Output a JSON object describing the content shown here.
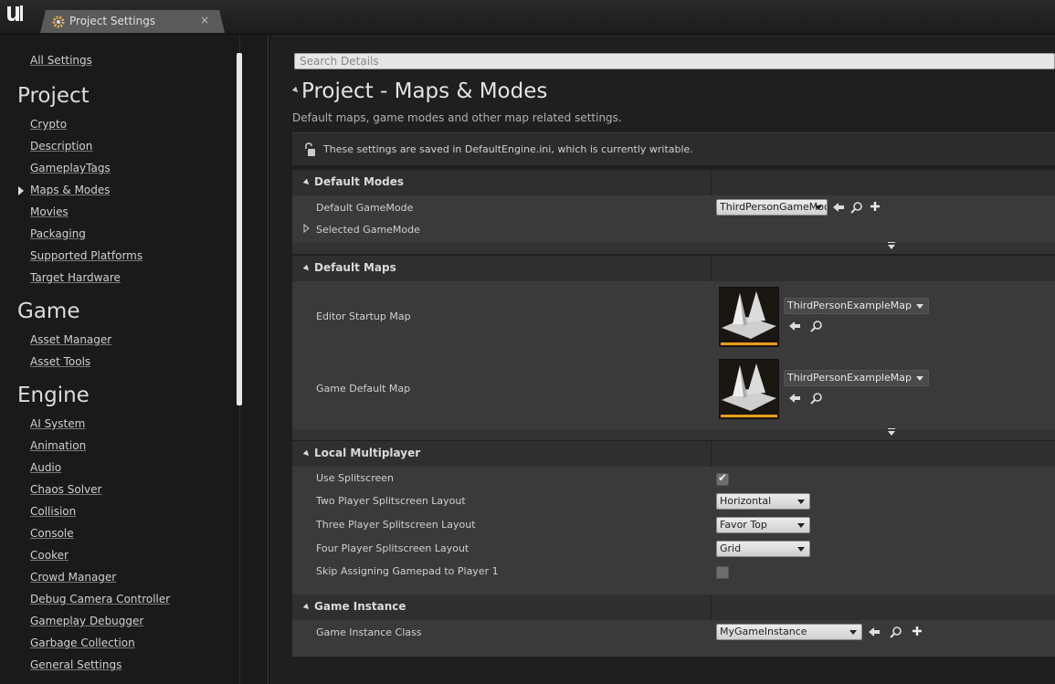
{
  "window": {
    "tab_title": "Project Settings",
    "close_glyph": "×"
  },
  "sidebar": {
    "all_settings": "All Settings",
    "sections": [
      {
        "heading": "Project",
        "items": [
          "Crypto",
          "Description",
          "GameplayTags",
          "Maps & Modes",
          "Movies",
          "Packaging",
          "Supported Platforms",
          "Target Hardware"
        ]
      },
      {
        "heading": "Game",
        "items": [
          "Asset Manager",
          "Asset Tools"
        ]
      },
      {
        "heading": "Engine",
        "items": [
          "AI System",
          "Animation",
          "Audio",
          "Chaos Solver",
          "Collision",
          "Console",
          "Cooker",
          "Crowd Manager",
          "Debug Camera Controller",
          "Gameplay Debugger",
          "Garbage Collection",
          "General Settings"
        ]
      }
    ],
    "selected": "Maps & Modes"
  },
  "search": {
    "placeholder": "Search Details"
  },
  "page": {
    "title": "Project - Maps & Modes",
    "description": "Default maps, game modes and other map related settings.",
    "notice": "These settings are saved in DefaultEngine.ini, which is currently writable."
  },
  "default_modes": {
    "title": "Default Modes",
    "default_gamemode_label": "Default GameMode",
    "default_gamemode_value": "ThirdPersonGameMode",
    "selected_gamemode_label": "Selected GameMode"
  },
  "default_maps": {
    "title": "Default Maps",
    "editor_startup_label": "Editor Startup Map",
    "editor_startup_value": "ThirdPersonExampleMap",
    "game_default_label": "Game Default Map",
    "game_default_value": "ThirdPersonExampleMap"
  },
  "local_multiplayer": {
    "title": "Local Multiplayer",
    "use_splitscreen_label": "Use Splitscreen",
    "use_splitscreen_checked": true,
    "two_player_label": "Two Player Splitscreen Layout",
    "two_player_value": "Horizontal",
    "three_player_label": "Three Player Splitscreen Layout",
    "three_player_value": "Favor Top",
    "four_player_label": "Four Player Splitscreen Layout",
    "four_player_value": "Grid",
    "skip_gamepad_label": "Skip Assigning Gamepad to Player 1",
    "skip_gamepad_checked": false
  },
  "game_instance": {
    "title": "Game Instance",
    "class_label": "Game Instance Class",
    "class_value": "MyGameInstance"
  },
  "colors": {
    "accent_orange": "#e89a1e",
    "panel": "#3a3a3a",
    "header": "#2f2f2f"
  }
}
